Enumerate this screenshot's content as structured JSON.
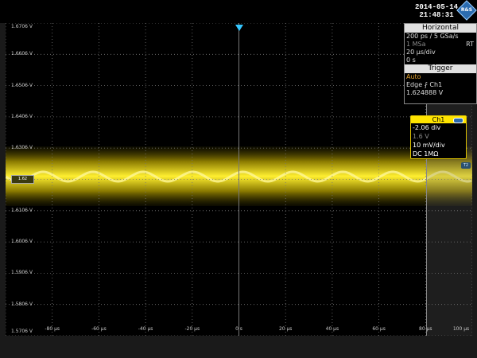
{
  "status": {
    "date": "2014-05-14",
    "time": "21:48:31",
    "logo": "R&S"
  },
  "waveform": {
    "ylabels": [
      "1.5706 V",
      "1.5806 V",
      "1.5906 V",
      "1.6006 V",
      "1.6106 V",
      "1.6206 V",
      "1.6306 V",
      "1.6406 V",
      "1.6506 V",
      "1.6606 V",
      "1.6706 V"
    ],
    "xlabels": [
      "-80 µs",
      "-60 µs",
      "-40 µs",
      "-20 µs",
      "0 s",
      "20 µs",
      "40 µs",
      "60 µs",
      "80 µs",
      "100 µs"
    ],
    "channel_marker": "1.62",
    "trigger_level_marker": "T2",
    "trace_color": "#ffe800"
  },
  "horizontal": {
    "title": "Horizontal",
    "timebase": "200 ps / 5 GSa/s",
    "record": "1 MSa",
    "mode": "RT",
    "scale": "20 µs/div",
    "position": "0 s"
  },
  "trigger": {
    "title": "Trigger",
    "mode": "Auto",
    "type": "Edge",
    "source": "Ch1",
    "level": "1.624888 V"
  },
  "ch1": {
    "title": "Ch1",
    "offset_div": "-2.06 div",
    "offset_v": "1.6 V",
    "scale": "10 mV/div",
    "coupling": "DC 1MΩ"
  },
  "colors": {
    "accent_blue": "#35c7ff",
    "ch1_yellow": "#ffe400",
    "auto_orange": "#e0a030"
  }
}
